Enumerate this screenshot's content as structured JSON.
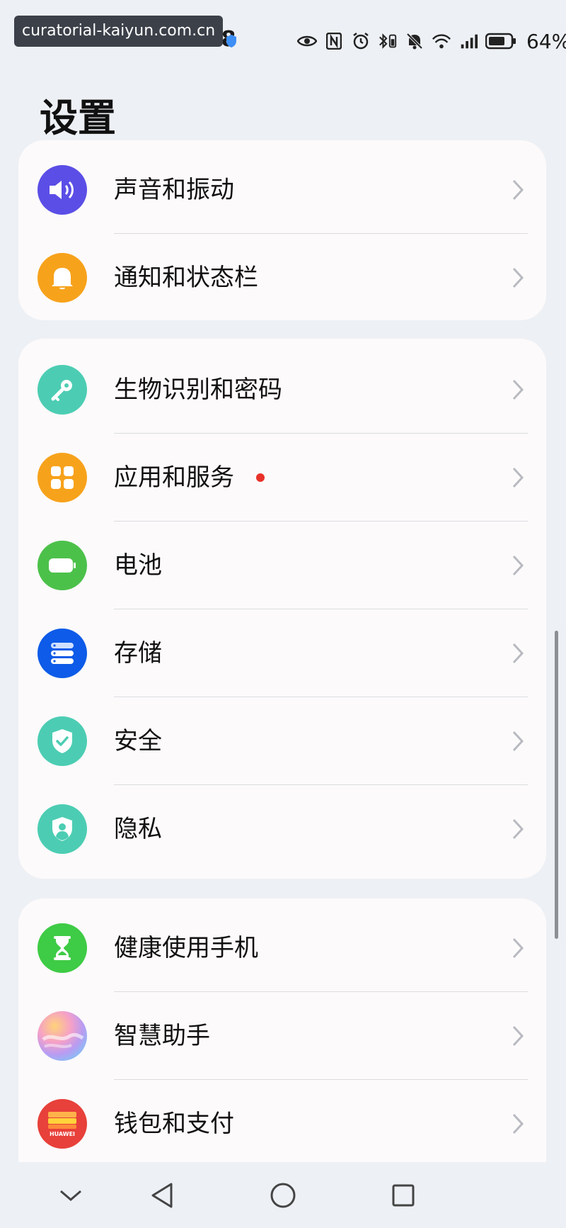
{
  "status_bar": {
    "watermark": "curatorial-kaiyun.com.cn",
    "time": "10:18",
    "battery": "64%"
  },
  "title": "设置",
  "groups": [
    {
      "items": [
        {
          "label": "声音和振动",
          "icon": "speaker-icon",
          "color": "#5b4ee6"
        },
        {
          "label": "通知和状态栏",
          "icon": "bell-icon",
          "color": "#f7a21b"
        }
      ]
    },
    {
      "items": [
        {
          "label": "生物识别和密码",
          "icon": "key-icon",
          "color": "#4ccdb3"
        },
        {
          "label": "应用和服务",
          "icon": "apps-grid-icon",
          "color": "#f7a21b",
          "badge": true
        },
        {
          "label": "电池",
          "icon": "battery-icon",
          "color": "#4cc14a"
        },
        {
          "label": "存储",
          "icon": "storage-icon",
          "color": "#0d5be8"
        },
        {
          "label": "安全",
          "icon": "security-shield-icon",
          "color": "#4ccdb3"
        },
        {
          "label": "隐私",
          "icon": "privacy-shield-icon",
          "color": "#4ccdb3"
        }
      ]
    },
    {
      "items": [
        {
          "label": "健康使用手机",
          "icon": "hourglass-icon",
          "color": "#3ecb45"
        },
        {
          "label": "智慧助手",
          "icon": "assistant-icon",
          "color": "#e9a3d8"
        },
        {
          "label": "钱包和支付",
          "icon": "wallet-icon",
          "color": "#e8403a",
          "icon_text": "HUAWEI"
        }
      ]
    }
  ],
  "colors": {
    "background": "#edf0f4",
    "card": "#fcfafb",
    "badge": "#e8322a"
  }
}
